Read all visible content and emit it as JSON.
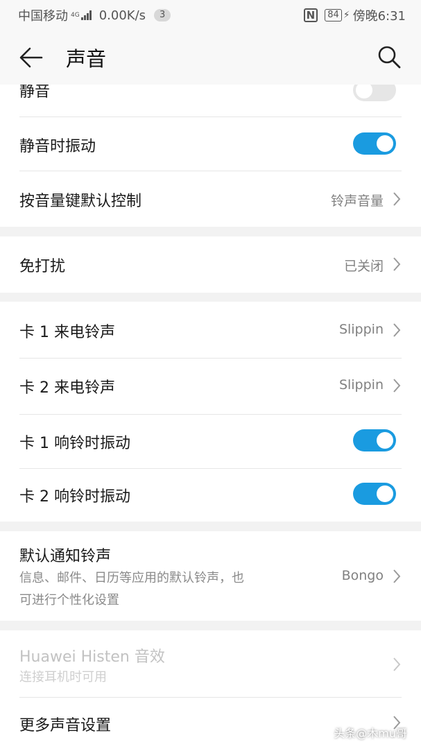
{
  "status_bar": {
    "carrier": "中国移动",
    "network": "4G",
    "speed": "0.00K/s",
    "notif_count": "3",
    "battery": "84",
    "time": "傍晚6:31"
  },
  "header": {
    "title": "声音",
    "back_icon": "arrow-left",
    "search_icon": "magnifier"
  },
  "section1": {
    "mute_label": "静音",
    "mute_on": false,
    "vibrate_silent_label": "静音时振动",
    "vibrate_silent_on": true,
    "volume_key_label": "按音量键默认控制",
    "volume_key_value": "铃声音量"
  },
  "section2": {
    "dnd_label": "免打扰",
    "dnd_value": "已关闭"
  },
  "section3": {
    "sim1_ringtone_label": "卡 1 来电铃声",
    "sim1_ringtone_value": "Slippin",
    "sim2_ringtone_label": "卡 2 来电铃声",
    "sim2_ringtone_value": "Slippin",
    "sim1_vibrate_label": "卡 1 响铃时振动",
    "sim1_vibrate_on": true,
    "sim2_vibrate_label": "卡 2 响铃时振动",
    "sim2_vibrate_on": true
  },
  "section4": {
    "notif_label": "默认通知铃声",
    "notif_sub_line1": "信息、邮件、日历等应用的默认铃声，也",
    "notif_sub_line2": "可进行个性化设置",
    "notif_value": "Bongo"
  },
  "section5": {
    "histen_label": "Huawei Histen 音效",
    "histen_sub": "连接耳机时可用",
    "more_label": "更多声音设置"
  },
  "watermark": "头条@木mu哥",
  "colors": {
    "accent": "#1a9be0",
    "background": "#f2f2f2"
  }
}
